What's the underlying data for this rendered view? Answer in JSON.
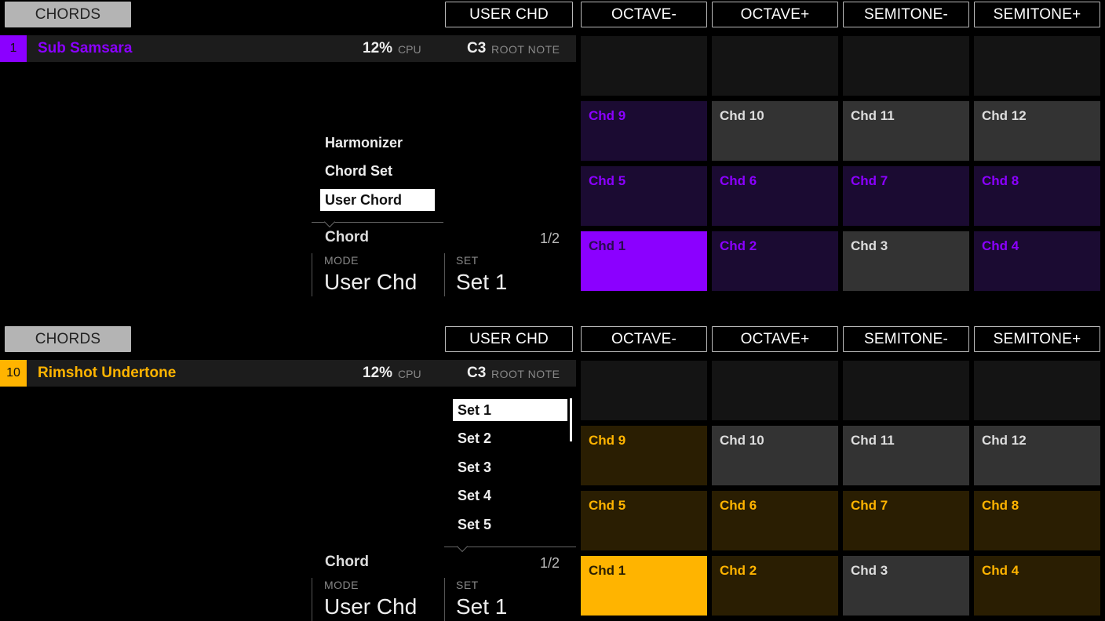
{
  "colors": {
    "purple": "#8b00ff",
    "purple_dim_bg": "#1b0b32",
    "amber": "#ffb400",
    "amber_dim_bg": "#2a1e02",
    "grey_pad": "#333333",
    "empty_pad": "#141414"
  },
  "top": {
    "header": {
      "chords_button": "CHORDS",
      "user_chd_button": "USER CHD",
      "octave_minus": "OCTAVE-",
      "octave_plus": "OCTAVE+",
      "semitone_minus": "SEMITONE-",
      "semitone_plus": "SEMITONE+"
    },
    "info": {
      "number": "1",
      "instrument": "Sub Samsara",
      "cpu_value": "12%",
      "cpu_label": "CPU",
      "root_value": "C3",
      "root_label": "ROOT NOTE"
    },
    "menu": {
      "items": [
        "Harmonizer",
        "Chord Set",
        "User Chord"
      ],
      "selected": "User Chord"
    },
    "params": {
      "section": "Chord",
      "page": "1/2",
      "mode_label": "MODE",
      "mode_value": "User Chd",
      "set_label": "SET",
      "set_value": "Set 1"
    },
    "pads": {
      "row1": [
        "Chd 9",
        "Chd 10",
        "Chd 11",
        "Chd 12"
      ],
      "row2": [
        "Chd 5",
        "Chd 6",
        "Chd 7",
        "Chd 8"
      ],
      "row3": [
        "Chd 1",
        "Chd 2",
        "Chd 3",
        "Chd 4"
      ]
    }
  },
  "bottom": {
    "header": {
      "chords_button": "CHORDS",
      "user_chd_button": "USER CHD",
      "octave_minus": "OCTAVE-",
      "octave_plus": "OCTAVE+",
      "semitone_minus": "SEMITONE-",
      "semitone_plus": "SEMITONE+"
    },
    "info": {
      "number": "10",
      "instrument": "Rimshot Undertone",
      "cpu_value": "12%",
      "cpu_label": "CPU",
      "root_value": "C3",
      "root_label": "ROOT NOTE"
    },
    "menu": {
      "items": [
        "Set 1",
        "Set 2",
        "Set 3",
        "Set 4",
        "Set 5"
      ],
      "selected": "Set 1"
    },
    "params": {
      "section": "Chord",
      "page": "1/2",
      "mode_label": "MODE",
      "mode_value": "User Chd",
      "set_label": "SET",
      "set_value": "Set 1"
    },
    "pads": {
      "row1": [
        "Chd 9",
        "Chd 10",
        "Chd 11",
        "Chd 12"
      ],
      "row2": [
        "Chd 5",
        "Chd 6",
        "Chd 7",
        "Chd 8"
      ],
      "row3": [
        "Chd 1",
        "Chd 2",
        "Chd 3",
        "Chd 4"
      ]
    }
  }
}
